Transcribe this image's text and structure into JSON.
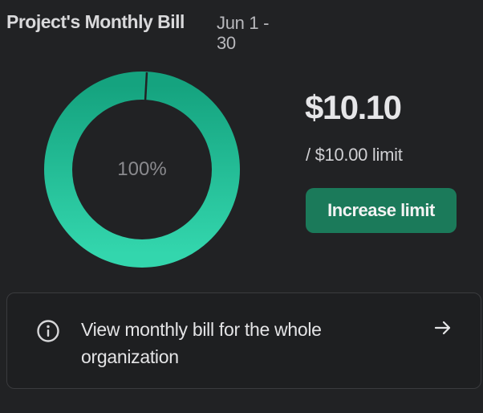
{
  "header": {
    "title": "Project's Monthly Bill",
    "date_range": "Jun 1 - 30"
  },
  "usage": {
    "percent_label": "100%",
    "percent_value": 1.0,
    "amount": "$10.10",
    "limit_text": "/ $10.00 limit",
    "increase_button_label": "Increase limit"
  },
  "colors": {
    "ring_top": "#15a37f",
    "ring_bottom": "#33d6ad",
    "button": "#1b7a5a",
    "background": "#212224"
  },
  "org_link": {
    "icon": "info-icon",
    "text": "View monthly bill for the whole organization",
    "arrow_icon": "arrow-right-icon"
  }
}
